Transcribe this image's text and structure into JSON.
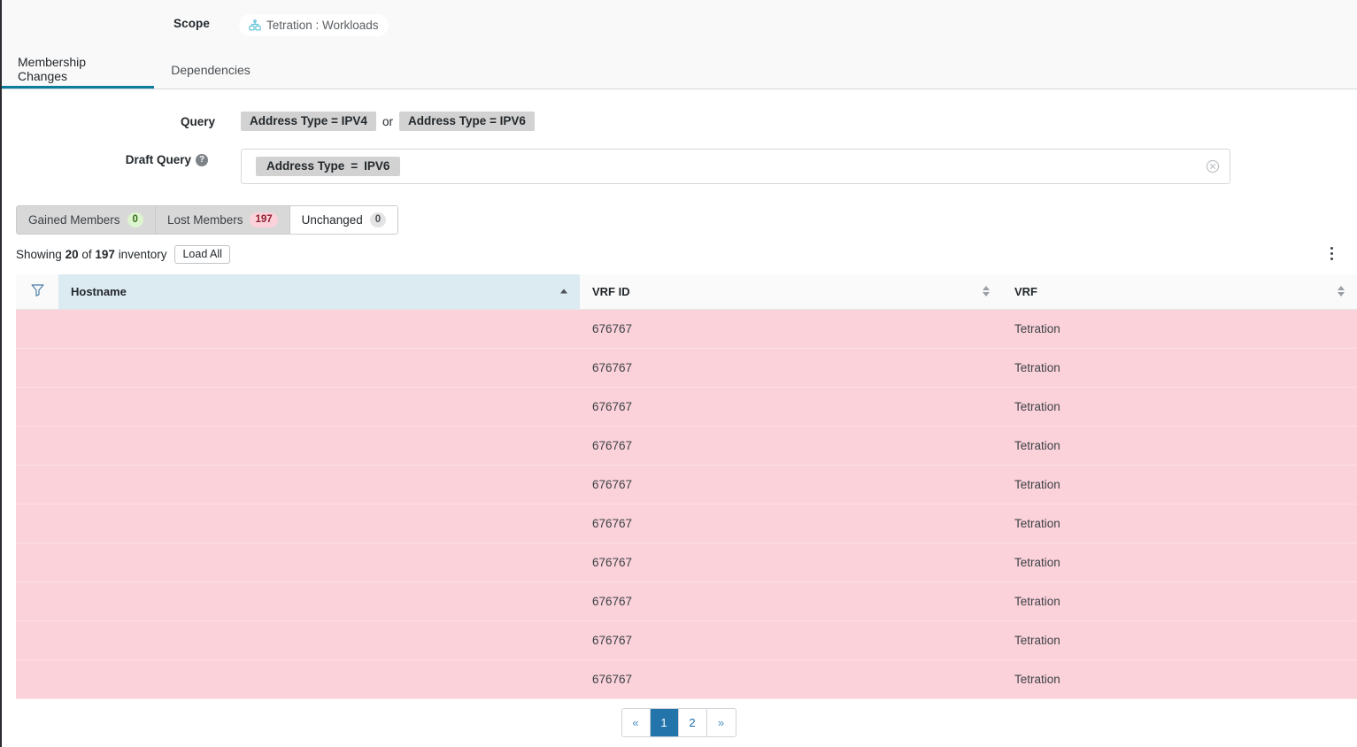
{
  "scope": {
    "label": "Scope",
    "chip_text": "Tetration : Workloads",
    "chip_icon": "scope-icon"
  },
  "tabs": [
    {
      "label": "Membership Changes",
      "active": true
    },
    {
      "label": "Dependencies",
      "active": false
    }
  ],
  "query": {
    "label": "Query",
    "chips": [
      "Address Type = IPV4",
      "Address Type = IPV6"
    ],
    "conjunction": "or"
  },
  "draft_query": {
    "label": "Draft Query",
    "help_icon": "question-mark-icon",
    "chip": {
      "field": "Address Type",
      "operator": "=",
      "value": "IPV6"
    },
    "clear_icon": "circle-x-icon"
  },
  "member_tabs": [
    {
      "label": "Gained Members",
      "count": "0",
      "badge": "badge-green",
      "active": false
    },
    {
      "label": "Lost Members",
      "count": "197",
      "badge": "badge-red",
      "active": false
    },
    {
      "label": "Unchanged",
      "count": "0",
      "badge": "badge-gray",
      "active": true
    }
  ],
  "showing": {
    "prefix": "Showing",
    "shown": "20",
    "middle": "of",
    "total": "197",
    "suffix": "inventory",
    "load_all_label": "Load All",
    "kebab_icon": "more-vertical-icon"
  },
  "table": {
    "filter_icon": "filter-funnel-icon",
    "columns": [
      {
        "key": "hostname",
        "label": "Hostname",
        "sorted": true,
        "sort_dir": "asc"
      },
      {
        "key": "vrf_id",
        "label": "VRF ID",
        "sorted": false,
        "sort_dir": "none"
      },
      {
        "key": "vrf",
        "label": "VRF",
        "sorted": false,
        "sort_dir": "none"
      }
    ],
    "rows": [
      {
        "hostname": "",
        "vrf_id": "676767",
        "vrf": "Tetration"
      },
      {
        "hostname": "",
        "vrf_id": "676767",
        "vrf": "Tetration"
      },
      {
        "hostname": "",
        "vrf_id": "676767",
        "vrf": "Tetration"
      },
      {
        "hostname": "",
        "vrf_id": "676767",
        "vrf": "Tetration"
      },
      {
        "hostname": "",
        "vrf_id": "676767",
        "vrf": "Tetration"
      },
      {
        "hostname": "",
        "vrf_id": "676767",
        "vrf": "Tetration"
      },
      {
        "hostname": "",
        "vrf_id": "676767",
        "vrf": "Tetration"
      },
      {
        "hostname": "",
        "vrf_id": "676767",
        "vrf": "Tetration"
      },
      {
        "hostname": "",
        "vrf_id": "676767",
        "vrf": "Tetration"
      },
      {
        "hostname": "",
        "vrf_id": "676767",
        "vrf": "Tetration"
      }
    ]
  },
  "pagination": {
    "prev_label": "«",
    "next_label": "»",
    "pages": [
      "1",
      "2"
    ],
    "current": "1"
  },
  "colors": {
    "accent_tab": "#0d7d9c",
    "row_removed": "#fcd2da",
    "sorted_header": "#dceaf2",
    "pager_active": "#2374ab"
  }
}
